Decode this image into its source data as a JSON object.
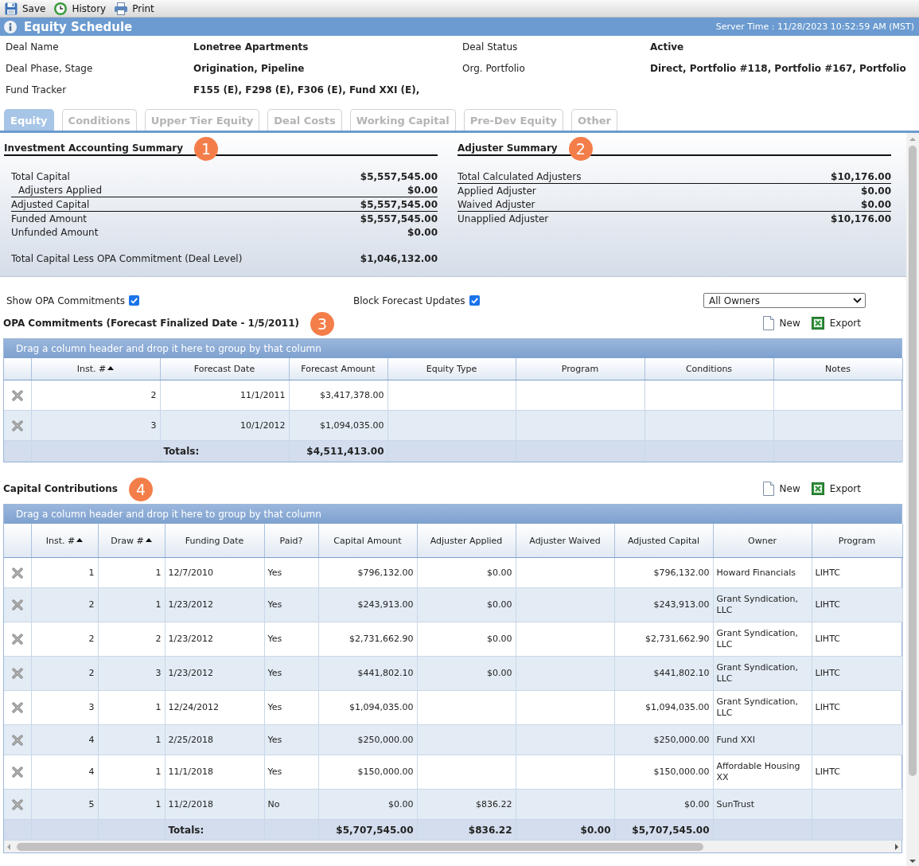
{
  "toolbar": {
    "items": [
      {
        "label": "Save"
      },
      {
        "label": "History"
      },
      {
        "label": "Print"
      }
    ]
  },
  "window": {
    "title": "Equity Schedule",
    "server_time": "Server Time : 11/28/2023 10:52:59 AM (MST)"
  },
  "deal_info": [
    {
      "label": "Deal Name",
      "value": "Lonetree Apartments"
    },
    {
      "label": "Deal Status",
      "value": "Active"
    },
    {
      "label": "Deal Phase, Stage",
      "value": "Origination, Pipeline"
    },
    {
      "label": "Org. Portfolio",
      "value": "Direct, Portfolio #118, Portfolio #167, Portfolio"
    },
    {
      "label": "Fund Tracker",
      "value": "F155 (E), F298 (E), F306 (E), Fund XXI (E),"
    }
  ],
  "tabs": [
    {
      "label": "Equity",
      "selected": true
    },
    {
      "label": "Conditions",
      "selected": false
    },
    {
      "label": "Upper Tier Equity",
      "selected": false
    },
    {
      "label": "Deal Costs",
      "selected": false
    },
    {
      "label": "Working Capital",
      "selected": false
    },
    {
      "label": "Pre-Dev Equity",
      "selected": false
    },
    {
      "label": "Other",
      "selected": false
    }
  ],
  "summaries": [
    {
      "title": "Investment Accounting Summary",
      "callout": "1",
      "rows": [
        {
          "label": "Total Capital",
          "value": "$5,557,545.00",
          "underlined": false,
          "children": [
            {
              "label": "Adjusters Applied",
              "value": "$0.00",
              "underlined": true
            }
          ]
        },
        {
          "label": "Adjusted Capital",
          "value": "$5,557,545.00",
          "underlined": true
        },
        {
          "label": "Funded Amount",
          "value": "$5,557,545.00",
          "underlined": false
        },
        {
          "label": "Unfunded Amount",
          "value": "$0.00",
          "underlined": false
        }
      ],
      "footer": {
        "label": "Total Capital Less OPA Commitment (Deal Level)",
        "value": "$1,046,132.00"
      }
    },
    {
      "title": "Adjuster Summary",
      "callout": "2",
      "rows": [
        {
          "label": "Total Calculated Adjusters",
          "value": "$10,176.00",
          "underlined": true
        },
        {
          "label": "Applied Adjuster",
          "value": "$0.00",
          "underlined": false
        },
        {
          "label": "Waived Adjuster",
          "value": "$0.00",
          "underlined": true
        },
        {
          "label": "Unapplied Adjuster",
          "value": "$10,176.00",
          "underlined": false
        }
      ]
    }
  ],
  "filters": {
    "options": [
      {
        "label": "Show OPA Commitments",
        "checked": true
      },
      {
        "label": "Block Forecast Updates",
        "checked": true
      }
    ],
    "owner_dropdown": {
      "value": "All Owners"
    }
  },
  "grids": [
    {
      "title": "OPA Commitments (Forecast Finalized Date - 1/5/2011)",
      "callout": "3",
      "actions": [
        {
          "label": "New"
        },
        {
          "label": "Export"
        }
      ],
      "group_hint": "Drag a column header and drop it here to group by that column",
      "columns": [
        {
          "label": "Inst. #",
          "sorted": true,
          "kind": "numeric"
        },
        {
          "label": "Forecast Date",
          "sorted": false,
          "kind": "numeric"
        },
        {
          "label": "Forecast Amount",
          "sorted": false,
          "kind": "numeric"
        },
        {
          "label": "Equity Type",
          "sorted": false,
          "kind": "text"
        },
        {
          "label": "Program",
          "sorted": false,
          "kind": "text"
        },
        {
          "label": "Conditions",
          "sorted": false,
          "kind": "text"
        },
        {
          "label": "Notes",
          "sorted": false,
          "kind": "text"
        }
      ],
      "rows": [
        [
          "2",
          "11/1/2011",
          "$3,417,378.00"
        ],
        [
          "3",
          "10/1/2012",
          "$1,094,035.00"
        ]
      ],
      "totals": {
        "label": "Totals:",
        "values": [
          "$4,511,413.00"
        ]
      }
    },
    {
      "title": "Capital Contributions",
      "callout": "4",
      "actions": [
        {
          "label": "New"
        },
        {
          "label": "Export"
        }
      ],
      "group_hint": "Drag a column header and drop it here to group by that column",
      "columns": [
        {
          "label": "Inst. #",
          "sorted": true,
          "kind": "numeric"
        },
        {
          "label": "Draw #",
          "sorted": true,
          "kind": "numeric"
        },
        {
          "label": "Funding Date",
          "sorted": false,
          "kind": "text"
        },
        {
          "label": "Paid?",
          "sorted": false,
          "kind": "text"
        },
        {
          "label": "Capital Amount",
          "sorted": false,
          "kind": "numeric"
        },
        {
          "label": "Adjuster Applied",
          "sorted": false,
          "kind": "numeric"
        },
        {
          "label": "Adjuster Waived",
          "sorted": false,
          "kind": "numeric"
        },
        {
          "label": "Adjusted Capital",
          "sorted": false,
          "kind": "numeric"
        },
        {
          "label": "Owner",
          "sorted": false,
          "kind": "text"
        },
        {
          "label": "Program",
          "sorted": false,
          "kind": "text"
        }
      ],
      "rows": [
        [
          "1",
          "1",
          "12/7/2010",
          "Yes",
          "$796,132.00",
          "$0.00",
          null,
          "$796,132.00",
          "Howard Financials",
          "LIHTC"
        ],
        [
          "2",
          "1",
          "1/23/2012",
          "Yes",
          "$243,913.00",
          "$0.00",
          null,
          "$243,913.00",
          "Grant Syndication, LLC",
          "LIHTC"
        ],
        [
          "2",
          "2",
          "1/23/2012",
          "Yes",
          "$2,731,662.90",
          "$0.00",
          null,
          "$2,731,662.90",
          "Grant Syndication, LLC",
          "LIHTC"
        ],
        [
          "2",
          "3",
          "1/23/2012",
          "Yes",
          "$441,802.10",
          "$0.00",
          null,
          "$441,802.10",
          "Grant Syndication, LLC",
          "LIHTC"
        ],
        [
          "3",
          "1",
          "12/24/2012",
          "Yes",
          "$1,094,035.00",
          null,
          null,
          "$1,094,035.00",
          "Grant Syndication, LLC",
          "LIHTC"
        ],
        [
          "4",
          "1",
          "2/25/2018",
          "Yes",
          "$250,000.00",
          null,
          null,
          "$250,000.00",
          "Fund XXI"
        ],
        [
          "4",
          "1",
          "11/1/2018",
          "Yes",
          "$150,000.00",
          null,
          null,
          "$150,000.00",
          "Affordable Housing XX",
          "LIHTC"
        ],
        [
          "5",
          "1",
          "11/2/2018",
          "No",
          "$0.00",
          "$836.22",
          null,
          "$0.00",
          "SunTrust"
        ]
      ],
      "totals": {
        "label": "Totals:",
        "values": [
          "$5,707,545.00",
          "$836.22",
          "$0.00",
          "$5,707,545.00"
        ]
      }
    }
  ]
}
